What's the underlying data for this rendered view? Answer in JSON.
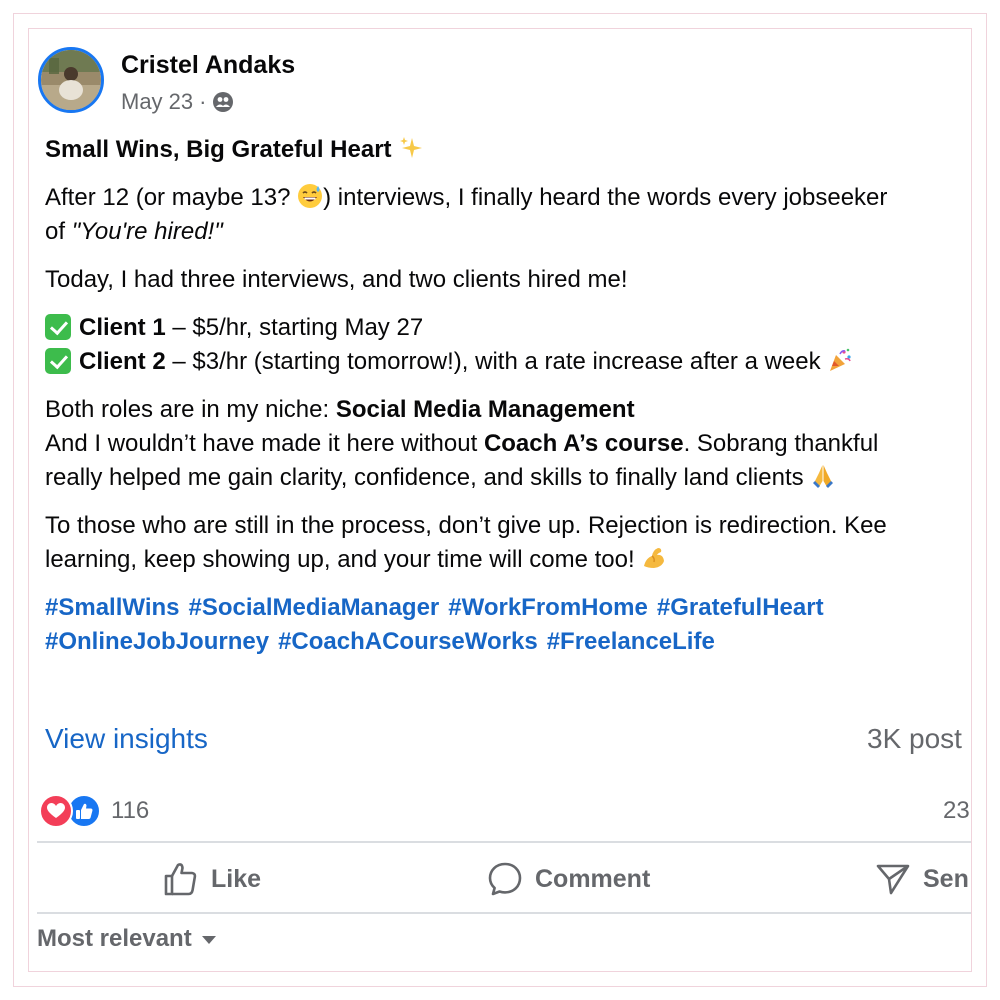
{
  "post": {
    "author": "Cristel Andaks",
    "date": "May 23",
    "separator": "·",
    "audience_icon": "friends-icon",
    "title": "Small Wins, Big Grateful Heart",
    "para1_a": "After 12 (or maybe 13? ",
    "para1_b": ") interviews, I finally heard the words every jobseeker",
    "para1_c": "of ",
    "para1_quote": "\"You're hired!\"",
    "para2": "Today, I had three interviews, and two clients hired me!",
    "client1_label": "Client 1",
    "client1_rest": " – $5/hr, starting May 27",
    "client2_label": "Client 2",
    "client2_rest": " – $3/hr (starting tomorrow!), with a rate increase after a week ",
    "niche_a": "Both roles are in my niche: ",
    "niche_b": "Social Media Management",
    "thanks_a": "And I wouldn’t have made it here without ",
    "thanks_b": "Coach A’s course",
    "thanks_c": ". Sobrang thankful",
    "thanks_d": "really helped me gain clarity, confidence, and skills to finally land clients ",
    "closing_a": "To those who are still in the process, don’t give up. Rejection is redirection. Kee",
    "closing_b": "learning, keep showing up, and your time will come too! ",
    "hashtags_line1": [
      "#SmallWins",
      "#SocialMediaManager",
      "#WorkFromHome",
      "#GratefulHeart"
    ],
    "hashtags_line2": [
      "#OnlineJobJourney",
      "#CoachACourseWorks",
      "#FreelanceLife"
    ]
  },
  "stats": {
    "insights_label": "View insights",
    "impressions": "3K post",
    "reaction_count": "116",
    "comment_count": "23"
  },
  "actions": {
    "like": "Like",
    "comment": "Comment",
    "send": "Sen"
  },
  "sort": {
    "label": "Most relevant"
  },
  "colors": {
    "link": "#1766c6",
    "secondary_text": "#65676b",
    "brand_blue": "#1877f2",
    "love_red": "#f33e58",
    "frame_pink": "#f0d3dc"
  }
}
